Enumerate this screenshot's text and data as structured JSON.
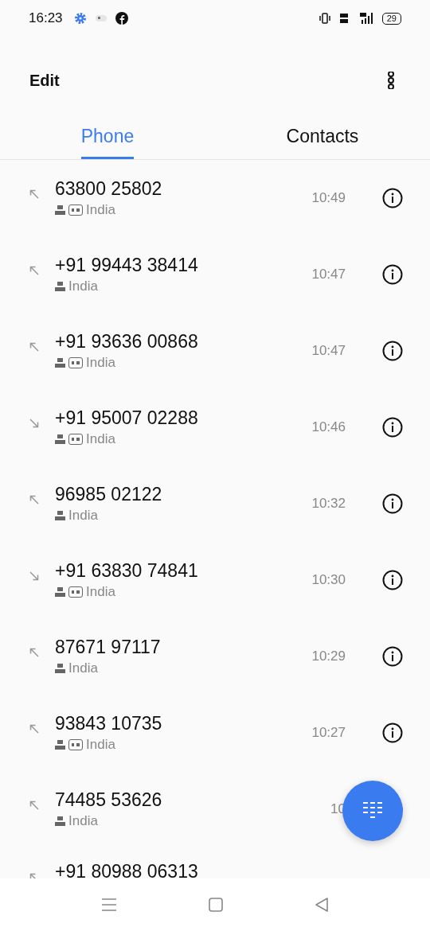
{
  "status_bar": {
    "time": "16:23",
    "battery": "29"
  },
  "header": {
    "edit": "Edit"
  },
  "tabs": [
    {
      "label": "Phone",
      "selected": true
    },
    {
      "label": "Contacts",
      "selected": false
    }
  ],
  "calls": [
    {
      "number": "63800 25802",
      "kind": "outgoing",
      "hd": true,
      "location": "India",
      "time": "10:49"
    },
    {
      "number": "+91 99443 38414",
      "kind": "outgoing",
      "hd": false,
      "location": "India",
      "time": "10:47"
    },
    {
      "number": "+91 93636 00868",
      "kind": "outgoing",
      "hd": true,
      "location": "India",
      "time": "10:47"
    },
    {
      "number": "+91 95007 02288",
      "kind": "incoming",
      "hd": true,
      "location": "India",
      "time": "10:46"
    },
    {
      "number": "96985 02122",
      "kind": "outgoing",
      "hd": false,
      "location": "India",
      "time": "10:32"
    },
    {
      "number": "+91 63830 74841",
      "kind": "incoming",
      "hd": true,
      "location": "India",
      "time": "10:30"
    },
    {
      "number": "87671 97117",
      "kind": "outgoing",
      "hd": false,
      "location": "India",
      "time": "10:29"
    },
    {
      "number": "93843 10735",
      "kind": "outgoing",
      "hd": true,
      "location": "India",
      "time": "10:27"
    },
    {
      "number": "74485 53626",
      "kind": "outgoing",
      "hd": false,
      "location": "India",
      "time": "10"
    },
    {
      "number": "+91 80988 06313",
      "kind": "outgoing"
    }
  ]
}
